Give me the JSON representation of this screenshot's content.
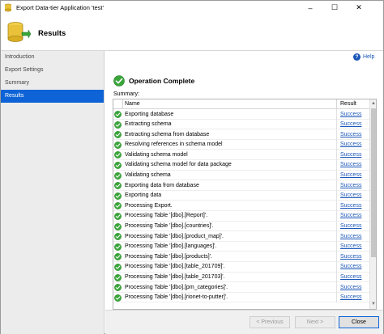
{
  "window": {
    "title": "Export Data-tier Application 'test'",
    "controls": {
      "minimize": "–",
      "maximize": "☐",
      "close": "✕"
    }
  },
  "header": {
    "title": "Results"
  },
  "sidebar": {
    "items": [
      {
        "label": "Introduction",
        "active": false
      },
      {
        "label": "Export Settings",
        "active": false
      },
      {
        "label": "Summary",
        "active": false
      },
      {
        "label": "Results",
        "active": true
      }
    ]
  },
  "help": {
    "label": "Help"
  },
  "status": {
    "text": "Operation Complete"
  },
  "summary": {
    "label": "Summary:",
    "columns": {
      "name": "Name",
      "result": "Result"
    },
    "rows": [
      {
        "name": "Exporting database",
        "result": "Success"
      },
      {
        "name": "Extracting schema",
        "result": "Success"
      },
      {
        "name": "Extracting schema from database",
        "result": "Success"
      },
      {
        "name": "Resolving references in schema model",
        "result": "Success"
      },
      {
        "name": "Validating schema model",
        "result": "Success"
      },
      {
        "name": "Validating schema model for data package",
        "result": "Success"
      },
      {
        "name": "Validating schema",
        "result": "Success"
      },
      {
        "name": "Exporting data from database",
        "result": "Success"
      },
      {
        "name": "Exporting data",
        "result": "Success"
      },
      {
        "name": "Processing Export.",
        "result": "Success"
      },
      {
        "name": "Processing Table '[dbo].[Report]'.",
        "result": "Success"
      },
      {
        "name": "Processing Table '[dbo].[countries]'.",
        "result": "Success"
      },
      {
        "name": "Processing Table '[dbo].[product_map]'.",
        "result": "Success"
      },
      {
        "name": "Processing Table '[dbo].[languages]'.",
        "result": "Success"
      },
      {
        "name": "Processing Table '[dbo].[products]'.",
        "result": "Success"
      },
      {
        "name": "Processing Table '[dbo].[table_201709]'.",
        "result": "Success"
      },
      {
        "name": "Processing Table '[dbo].[table_201703]'.",
        "result": "Success"
      },
      {
        "name": "Processing Table '[dbo].[pm_categories]'.",
        "result": "Success"
      },
      {
        "name": "Processing Table '[dbo].[rionet-to-putter]'.",
        "result": "Success"
      }
    ]
  },
  "footer": {
    "previous_label": "< Previous",
    "next_label": "Next >",
    "close_label": "Close"
  },
  "colors": {
    "accent": "#0e64d6",
    "link": "#1a56b8",
    "success": "#3aa63a"
  }
}
